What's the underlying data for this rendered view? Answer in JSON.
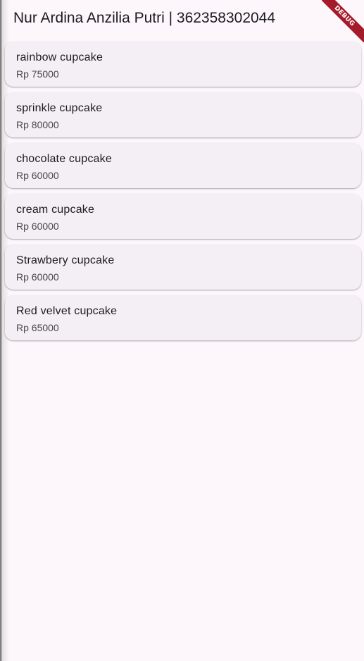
{
  "app_bar": {
    "title": "Nur Ardina Anzilia Putri | 362358302044"
  },
  "products": [
    {
      "name": "rainbow cupcake",
      "price": "Rp 75000"
    },
    {
      "name": "sprinkle cupcake",
      "price": "Rp 80000"
    },
    {
      "name": "chocolate cupcake",
      "price": "Rp 60000"
    },
    {
      "name": "cream cupcake",
      "price": "Rp 60000"
    },
    {
      "name": "Strawbery cupcake",
      "price": "Rp 60000"
    },
    {
      "name": "Red velvet cupcake",
      "price": "Rp 65000"
    }
  ],
  "debug_banner": {
    "label": "DEBUG",
    "color": "#a61b2b"
  },
  "colors": {
    "background": "#fdf7fc",
    "card": "#f4eff4",
    "text_primary": "#1d1b20",
    "text_secondary": "#49454f"
  }
}
